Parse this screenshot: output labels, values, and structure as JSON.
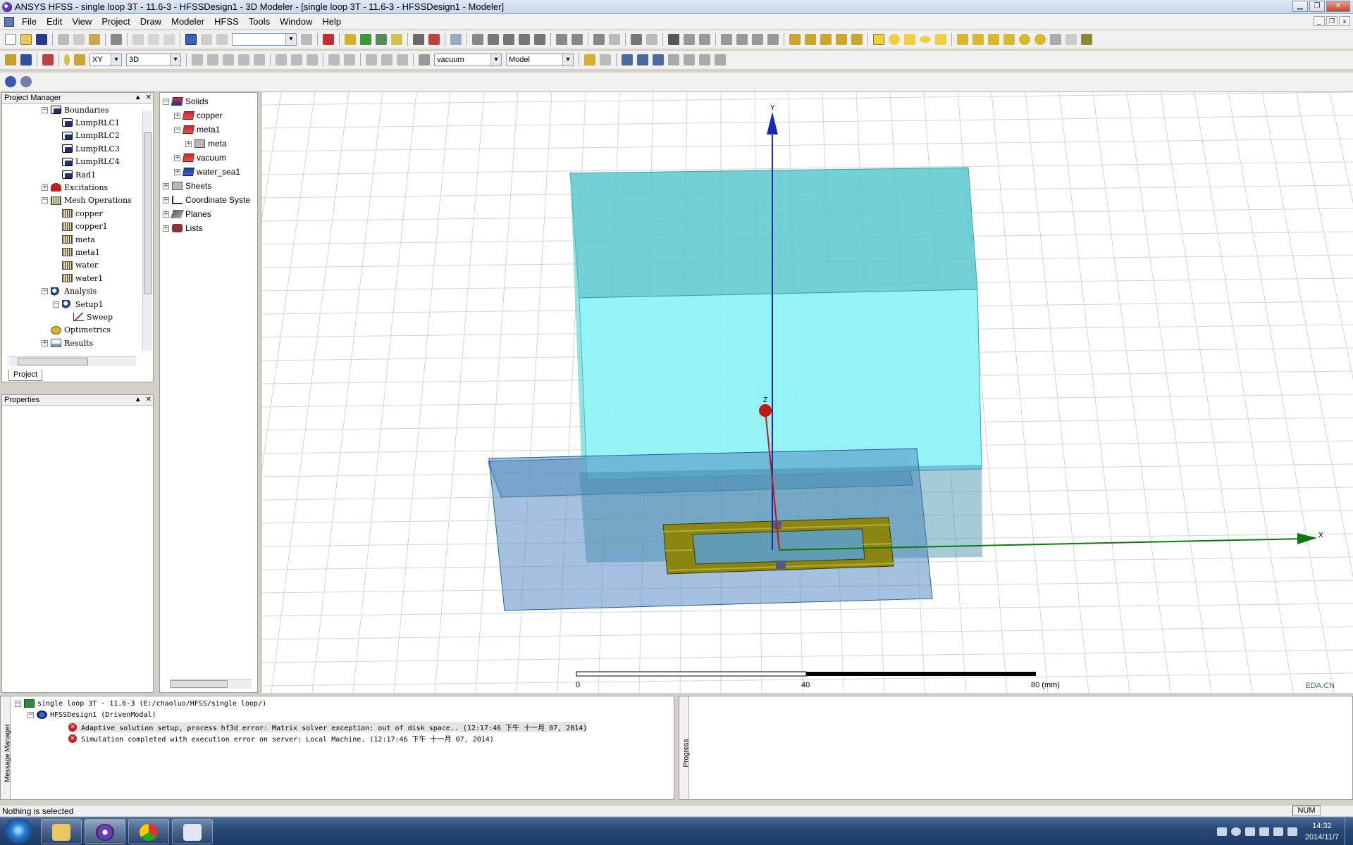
{
  "window": {
    "title": "ANSYS HFSS - single loop 3T - 11.6-3 - HFSSDesign1 - 3D Modeler - [single loop 3T - 11.6-3 - HFSSDesign1 - Modeler]"
  },
  "menu": [
    "File",
    "Edit",
    "View",
    "Project",
    "Draw",
    "Modeler",
    "HFSS",
    "Tools",
    "Window",
    "Help"
  ],
  "toolbar": {
    "plane_combo": "XY",
    "view_combo": "3D",
    "material_combo": "vacuum",
    "model_combo": "Model"
  },
  "project_manager": {
    "title": "Project Manager",
    "tab": "Project",
    "items": [
      {
        "label": "Boundaries",
        "icon": "boundary-icon",
        "level": 1,
        "expander": "−"
      },
      {
        "label": "LumpRLC1",
        "icon": "boundary-icon",
        "level": 2,
        "expander": ""
      },
      {
        "label": "LumpRLC2",
        "icon": "boundary-icon",
        "level": 2,
        "expander": ""
      },
      {
        "label": "LumpRLC3",
        "icon": "boundary-icon",
        "level": 2,
        "expander": ""
      },
      {
        "label": "LumpRLC4",
        "icon": "boundary-icon",
        "level": 2,
        "expander": ""
      },
      {
        "label": "Rad1",
        "icon": "boundary-icon",
        "level": 2,
        "expander": ""
      },
      {
        "label": "Excitations",
        "icon": "excitation-icon",
        "level": 1,
        "expander": "+"
      },
      {
        "label": "Mesh Operations",
        "icon": "mesh-icon",
        "level": 1,
        "expander": "−"
      },
      {
        "label": "copper",
        "icon": "mesh-icon",
        "level": 2,
        "expander": ""
      },
      {
        "label": "copper1",
        "icon": "mesh-icon",
        "level": 2,
        "expander": ""
      },
      {
        "label": "meta",
        "icon": "mesh-icon",
        "level": 2,
        "expander": ""
      },
      {
        "label": "meta1",
        "icon": "mesh-icon",
        "level": 2,
        "expander": ""
      },
      {
        "label": "water",
        "icon": "mesh-icon",
        "level": 2,
        "expander": ""
      },
      {
        "label": "water1",
        "icon": "mesh-icon",
        "level": 2,
        "expander": ""
      },
      {
        "label": "Analysis",
        "icon": "analysis-icon",
        "level": 1,
        "expander": "−"
      },
      {
        "label": "Setup1",
        "icon": "analysis-icon",
        "level": 2,
        "expander": "−"
      },
      {
        "label": "Sweep",
        "icon": "sweep-icon",
        "level": 3,
        "expander": ""
      },
      {
        "label": "Optimetrics",
        "icon": "optimetrics-icon",
        "level": 1,
        "expander": ""
      },
      {
        "label": "Results",
        "icon": "results-icon",
        "level": 1,
        "expander": "+"
      }
    ]
  },
  "properties": {
    "title": "Properties"
  },
  "model_tree": {
    "items": [
      {
        "label": "Solids",
        "icon": "solid-model-icon",
        "level": 0,
        "expander": "−"
      },
      {
        "label": "copper",
        "icon": "solid-red-icon",
        "level": 1,
        "expander": "+"
      },
      {
        "label": "meta1",
        "icon": "solid-red-icon",
        "level": 1,
        "expander": "−"
      },
      {
        "label": "meta",
        "icon": "sheet-object-icon",
        "level": 2,
        "expander": "+"
      },
      {
        "label": "vacuum",
        "icon": "solid-red-icon",
        "level": 1,
        "expander": "+"
      },
      {
        "label": "water_sea1",
        "icon": "solid-blue-icon",
        "level": 1,
        "expander": "+"
      },
      {
        "label": "Sheets",
        "icon": "sheet-icon",
        "level": 0,
        "expander": "+"
      },
      {
        "label": "Coordinate Syste",
        "icon": "coordinate-system-icon",
        "level": 0,
        "expander": "+"
      },
      {
        "label": "Planes",
        "icon": "plane-icon",
        "level": 0,
        "expander": "+"
      },
      {
        "label": "Lists",
        "icon": "list-icon",
        "level": 0,
        "expander": "+"
      }
    ]
  },
  "viewport": {
    "axis_labels": {
      "x": "X",
      "y": "Y",
      "z": "Z"
    },
    "scale": {
      "ticks": [
        "0",
        "40",
        "80 (mm)"
      ]
    }
  },
  "messages": {
    "panel_label": "Message Manager",
    "project_line": "single loop 3T - 11.6-3 (E:/chaoluo/HFSS/single loop/)",
    "design_line": "HFSSDesign1 (DrivenModal)",
    "errors": [
      "Adaptive solution setup, process hf3d error: Matrix solver exception: out of disk space.. (12:17:46 下午  十一月 07, 2014)",
      "Simulation completed with execution error on server: Local Machine. (12:17:46 下午  十一月 07, 2014)"
    ]
  },
  "progress": {
    "panel_label": "Progress"
  },
  "status": {
    "text": "Nothing is selected",
    "num": "NUM"
  },
  "taskbar": {
    "time": "14:32",
    "date": "2014/11/7"
  },
  "watermark": {
    "text": "EDA.CN"
  },
  "colors": {
    "water_box": "#5cd8dc",
    "substrate": "#4e86b8",
    "copper_loop": "#8b8614",
    "x_axis": "#0a7a0a",
    "y_axis": "#1a2ab0",
    "z_axis": "#c01818"
  }
}
